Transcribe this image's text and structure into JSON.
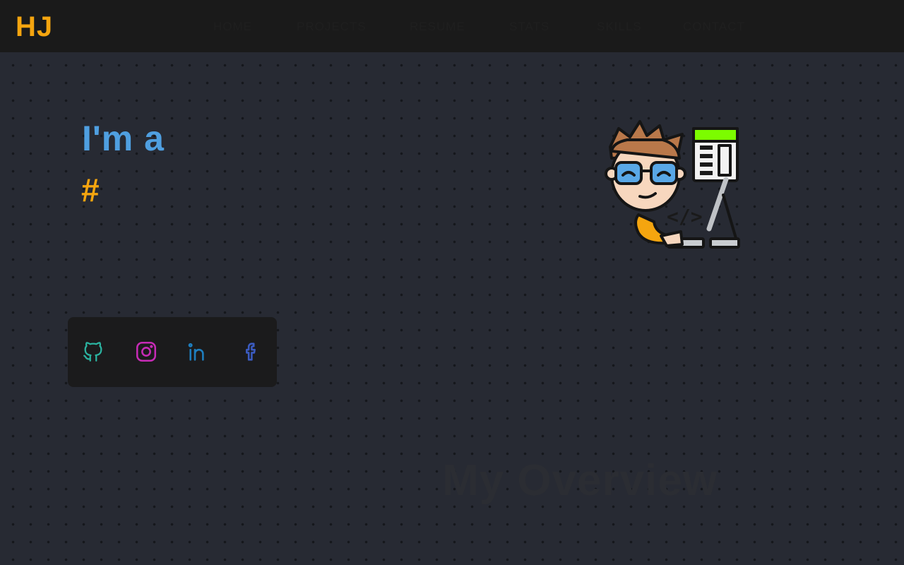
{
  "brand": {
    "logo": "HJ"
  },
  "nav": {
    "items": [
      {
        "label": "HOME"
      },
      {
        "label": "PROJECTS"
      },
      {
        "label": "RESUME"
      },
      {
        "label": "STATS"
      },
      {
        "label": "SKILLS"
      },
      {
        "label": "CONTACT"
      }
    ]
  },
  "hero": {
    "intro": "I'm a",
    "typed_text": "#",
    "intro_color": "#4f9fe0",
    "typed_color": "#f5a50f"
  },
  "social": {
    "items": [
      {
        "icon": "github-icon",
        "color": "#2bb3a0"
      },
      {
        "icon": "instagram-icon",
        "color": "#c62bb5"
      },
      {
        "icon": "linkedin-icon",
        "color": "#1e7fc0"
      },
      {
        "icon": "facebook-icon",
        "color": "#3b5bc0"
      }
    ]
  },
  "illustration": {
    "icon": "developer-avatar-icon"
  },
  "overview": {
    "title": "My Overview"
  },
  "colors": {
    "accent": "#f5a50f",
    "nav_background": "#1a1a1a",
    "page_background": "#272a33"
  }
}
